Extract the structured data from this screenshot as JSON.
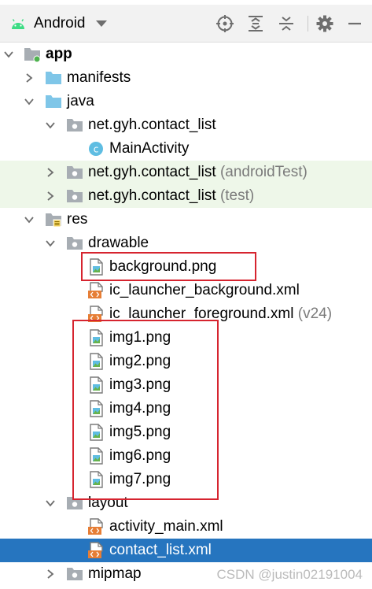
{
  "toolbar": {
    "view_label": "Android",
    "icons": [
      "android-icon",
      "dropdown-caret-icon",
      "locate-file-icon",
      "expand-all-icon",
      "collapse-all-icon",
      "gear-icon",
      "hide-panel-icon"
    ]
  },
  "tree": {
    "app": {
      "label": "app"
    },
    "manifests": {
      "label": "manifests"
    },
    "java": {
      "label": "java"
    },
    "pkg_main": {
      "label": "net.gyh.contact_list"
    },
    "main_activity": {
      "label": "MainActivity"
    },
    "pkg_android_test": {
      "label": "net.gyh.contact_list",
      "suffix": "(androidTest)"
    },
    "pkg_test": {
      "label": "net.gyh.contact_list",
      "suffix": "(test)"
    },
    "res": {
      "label": "res"
    },
    "drawable": {
      "label": "drawable"
    },
    "background_png": {
      "label": "background.png"
    },
    "ic_launcher_background": {
      "label": "ic_launcher_background.xml"
    },
    "ic_launcher_foreground": {
      "label": "ic_launcher_foreground.xml",
      "suffix": "(v24)"
    },
    "img1": {
      "label": "img1.png"
    },
    "img2": {
      "label": "img2.png"
    },
    "img3": {
      "label": "img3.png"
    },
    "img4": {
      "label": "img4.png"
    },
    "img5": {
      "label": "img5.png"
    },
    "img6": {
      "label": "img6.png"
    },
    "img7": {
      "label": "img7.png"
    },
    "layout": {
      "label": "layout"
    },
    "activity_main": {
      "label": "activity_main.xml"
    },
    "contact_list": {
      "label": "contact_list.xml"
    },
    "mipmap": {
      "label": "mipmap"
    }
  },
  "watermark": "CSDN @justin02191004",
  "colors": {
    "selection": "#2675bf",
    "test_band": "#eef7e9",
    "highlight_box": "#d6242f",
    "folder_blue": "#7fc6e8",
    "folder_gray": "#9aa0a6"
  }
}
